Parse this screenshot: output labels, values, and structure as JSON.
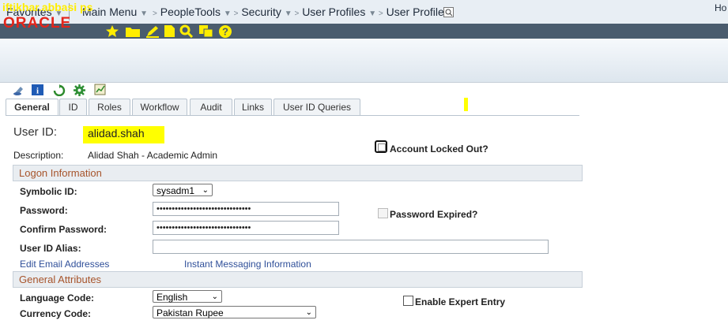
{
  "nav": {
    "favorites": "Favorites",
    "main_menu": "Main Menu",
    "breadcrumb": [
      "PeopleTools",
      "Security",
      "User Profiles",
      "User Profiles"
    ]
  },
  "user_bar": {
    "username": "iftikhar.abbasi ps"
  },
  "header": {
    "logo": "ORACLE",
    "home": "Ho"
  },
  "tabs": [
    "General",
    "ID",
    "Roles",
    "Workflow",
    "Audit",
    "Links",
    "User ID Queries"
  ],
  "form": {
    "user_id_label": "User ID:",
    "user_id_value": "alidad.shah",
    "description_label": "Description:",
    "description_value": "Alidad Shah - Academic Admin",
    "account_locked_label": "Account Locked Out?",
    "logon_section": "Logon Information",
    "symbolic_id_label": "Symbolic ID:",
    "symbolic_id_value": "sysadm1",
    "password_label": "Password:",
    "password_value": "•••••••••••••••••••••••••••••••",
    "confirm_password_label": "Confirm Password:",
    "confirm_password_value": "•••••••••••••••••••••••••••••••",
    "password_expired_label": "Password Expired?",
    "user_id_alias_label": "User ID Alias:",
    "user_id_alias_value": "",
    "edit_email_link": "Edit Email Addresses",
    "instant_messaging_link": "Instant Messaging Information",
    "general_section": "General Attributes",
    "language_code_label": "Language Code:",
    "language_code_value": "English",
    "enable_expert_label": "Enable Expert Entry",
    "currency_code_label": "Currency Code:",
    "currency_code_value": "Pakistan Rupee"
  },
  "colors": {
    "highlight": "#ffff00",
    "userbar_bg": "#4a5c6e",
    "section_title": "#a7542b",
    "link": "#2f4f99"
  }
}
